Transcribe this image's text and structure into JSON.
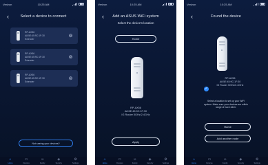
{
  "status": {
    "time": "10:25 AM",
    "carrier": "Verizon"
  },
  "screen1": {
    "title": "Select a device to connect",
    "devices": [
      {
        "model": "RP-AX56",
        "mac": "A8:5E:45:9C:1F:30",
        "detail": "Extender"
      },
      {
        "model": "RP-AX56",
        "mac": "A8:5E:45:9C:1F:30",
        "detail": "Extender"
      },
      {
        "model": "RP-AX56",
        "mac": "A8:5E:45:9C:1F:30",
        "detail": "Extender"
      }
    ],
    "wifi_icon": "wifi-icon",
    "help_label": "Not seeing your devices?"
  },
  "screen2": {
    "title": "Add an ASUS WiFi system",
    "subtitle": "Select the device's location",
    "location_value": "Home",
    "device_model": "RP-AX56",
    "device_mac": "A8:5E:45:9C:1F:30",
    "device_note": "IG Router 5GHz/2.4GHz",
    "apply_label": "Apply"
  },
  "screen3": {
    "title": "Found the device",
    "device_model": "RP-AX56",
    "device_mac": "A8:5E:45:9C:1F:30",
    "device_note": "IG Router 5GHz/2.4GHz",
    "desc_1": "Select a location to set up your WiFi",
    "desc_2": "system. Make sure your devices are within",
    "desc_3": "range of each other.",
    "button_1": "Home",
    "button_2": "Add another node"
  },
  "tabs": [
    {
      "label": "Home",
      "icon": "home-icon"
    },
    {
      "label": "Devices",
      "icon": "devices-icon"
    },
    {
      "label": "Family",
      "icon": "family-icon"
    },
    {
      "label": "Security",
      "icon": "security-icon"
    },
    {
      "label": "Settings",
      "icon": "settings-icon"
    }
  ]
}
